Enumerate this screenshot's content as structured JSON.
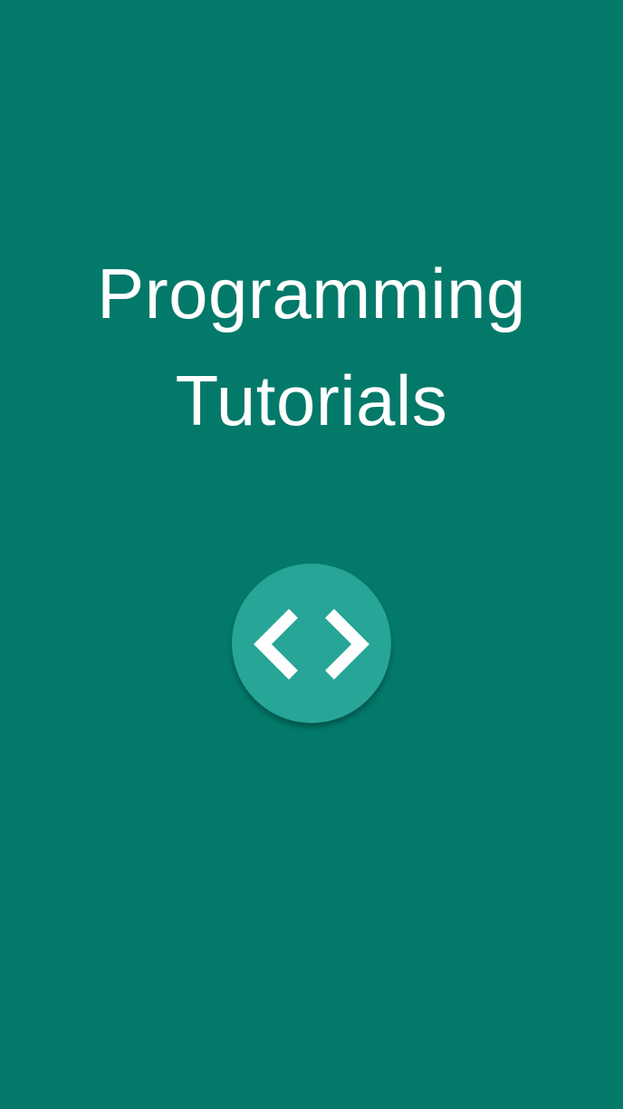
{
  "splash": {
    "title_line1": "Programming",
    "title_line2": "Tutorials",
    "logo_icon": "code-brackets-icon",
    "colors": {
      "background": "#03796A",
      "logo_circle": "#27A596",
      "text": "#FFFFFF"
    }
  }
}
